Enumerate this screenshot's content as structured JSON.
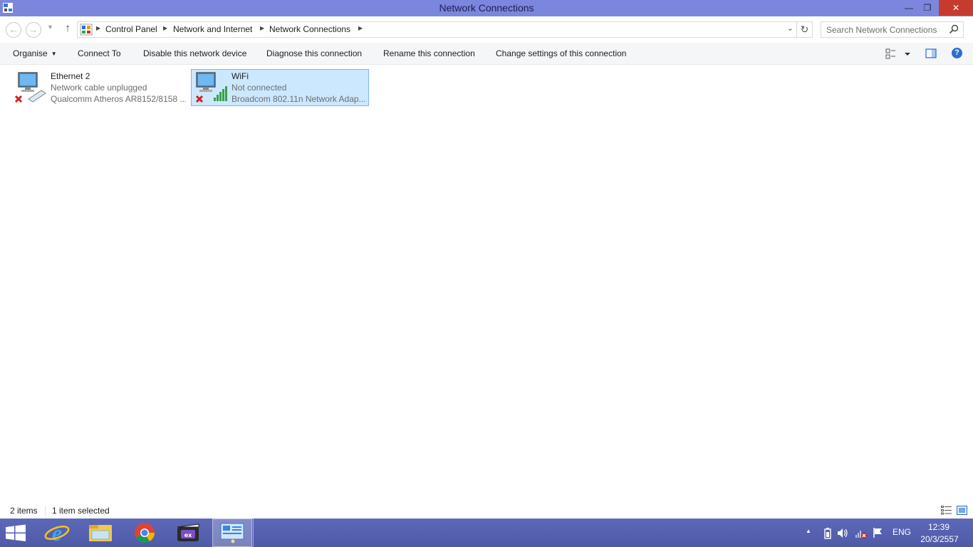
{
  "window": {
    "title": "Network Connections",
    "controls": {
      "minimize": "—",
      "restore": "❐",
      "close": "✕"
    }
  },
  "nav": {
    "back": "←",
    "forward": "→",
    "recent": "▼",
    "up": "↑"
  },
  "address": {
    "crumbs": [
      "Control Panel",
      "Network and Internet",
      "Network Connections"
    ],
    "separator": "▶",
    "dropdown": "⌄",
    "refresh": "↻"
  },
  "search": {
    "placeholder": "Search Network Connections"
  },
  "commands": {
    "organise": "Organise",
    "connect_to": "Connect To",
    "disable": "Disable this network device",
    "diagnose": "Diagnose this connection",
    "rename": "Rename this connection",
    "change_settings": "Change settings of this connection",
    "help": "?"
  },
  "items": [
    {
      "name": "Ethernet 2",
      "status": "Network cable unplugged",
      "device": "Qualcomm Atheros AR8152/8158 ...",
      "selected": false
    },
    {
      "name": "WiFi",
      "status": "Not connected",
      "device": "Broadcom 802.11n Network Adap...",
      "selected": true
    }
  ],
  "statusbar": {
    "count": "2 items",
    "selection": "1 item selected"
  },
  "taskbar": {
    "apps": [
      "start-icon",
      "internet-explorer-icon",
      "file-explorer-icon",
      "chrome-icon",
      "media-app-icon",
      "control-panel-icon"
    ],
    "tray": {
      "show_hidden": "▲",
      "language": "ENG",
      "time": "12:39",
      "date": "20/3/2557"
    }
  },
  "colors": {
    "titlebar": "#7b86dd",
    "taskbar": "#5560b0",
    "selection": "#cce8ff",
    "close": "#c73b2e"
  }
}
